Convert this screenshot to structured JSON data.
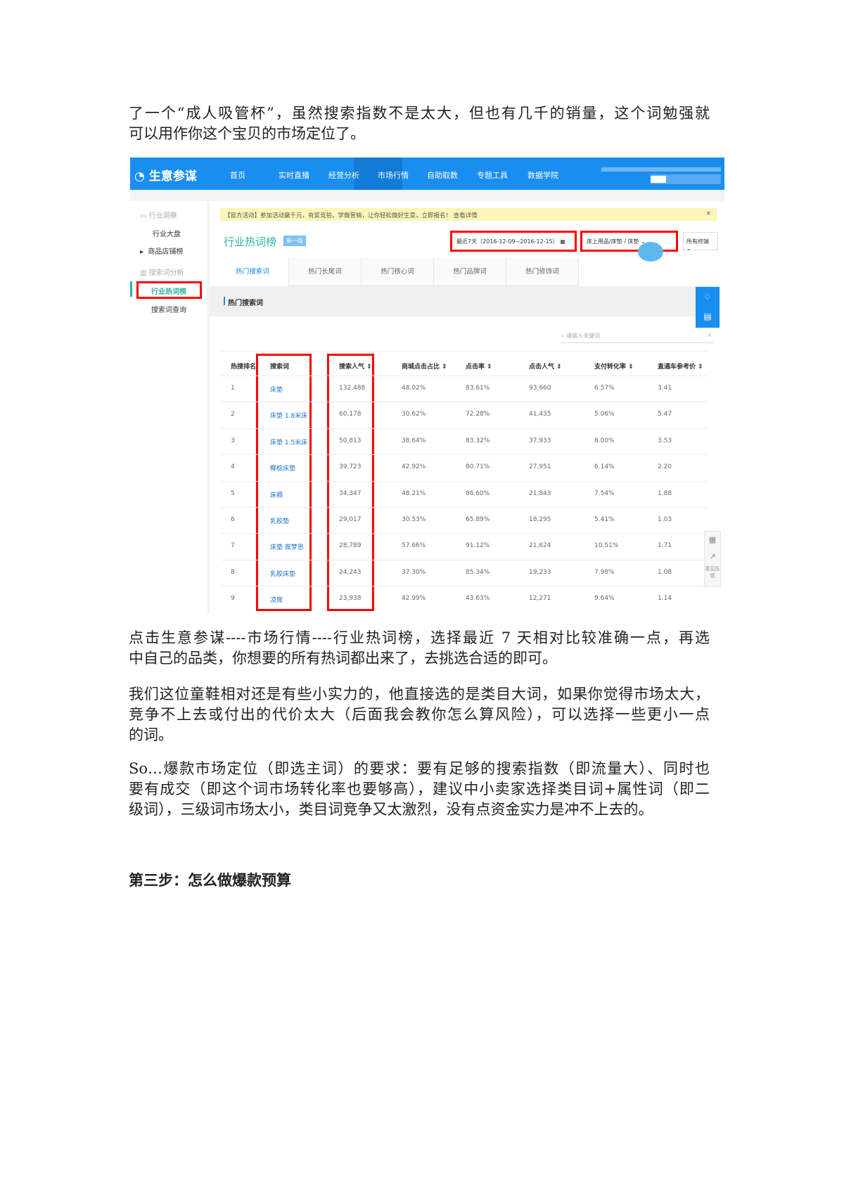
{
  "intro": {
    "lines": [
      "了一个“成人吸管杯”，虽然搜索指数不是太大，但也有几千的销量，这个词勉强就",
      "可以用作你这个宝贝的市场定位了。"
    ]
  },
  "screenshot": {
    "logo": "生意参谋",
    "nav": [
      "首页",
      "实时直播",
      "经营分析",
      "市场行情",
      "自助取数",
      "专题工具",
      "数据学院"
    ],
    "sidebar": {
      "group1": "行业洞察",
      "items1": [
        "行业大盘",
        "商品店铺榜"
      ],
      "group2": "搜索词分析",
      "active": "行业热词榜",
      "items2": [
        "搜索词查询"
      ]
    },
    "notice": "【官方活动】参加活动赢千元，有奖竞拍，学做营销，让你轻松做好生意，立即报名！ 查看详情",
    "notice_close": "×",
    "page_title": "行业热词榜",
    "badge": "新一版",
    "date_range": "最近7天（2016-12-09~2016-12-15）",
    "category": "床上用品/床垫 / 床垫",
    "terminal": "所有终端",
    "tabs": [
      "热门搜索词",
      "热门长尾词",
      "热门核心词",
      "热门品牌词",
      "热门修饰词"
    ],
    "section_title": "热门搜索词",
    "search_placeholder": "请输入关键词",
    "columns": [
      "热搜排名",
      "搜索词",
      "搜索人气 ⇕",
      "商城点击占比 ⇕",
      "点击率 ⇕",
      "点击人气 ⇕",
      "支付转化率 ⇕",
      "直通车参考价 ⇕"
    ],
    "rows": [
      [
        "1",
        "床垫",
        "132,488",
        "48.02%",
        "83.61%",
        "93,660",
        "6.57%",
        "3.41"
      ],
      [
        "2",
        "床垫 1.8米床",
        "60,178",
        "30.62%",
        "72.28%",
        "41,435",
        "5.06%",
        "5.47"
      ],
      [
        "3",
        "床垫 1.5米床",
        "50,813",
        "38.64%",
        "83.32%",
        "37,933",
        "8.00%",
        "3.53"
      ],
      [
        "4",
        "椰棕床垫",
        "39,723",
        "42.92%",
        "80.71%",
        "27,951",
        "6.14%",
        "2.20"
      ],
      [
        "5",
        "床褥",
        "34,347",
        "48.21%",
        "86.60%",
        "21,843",
        "7.54%",
        "1.88"
      ],
      [
        "6",
        "乳胶垫",
        "29,017",
        "30.53%",
        "65.89%",
        "18,295",
        "5.41%",
        "1.03"
      ],
      [
        "7",
        "床垫 席梦思",
        "28,789",
        "57.66%",
        "91.12%",
        "21,624",
        "10.51%",
        "1.71"
      ],
      [
        "8",
        "乳胶床垫",
        "24,243",
        "37.30%",
        "85.34%",
        "19,233",
        "7.98%",
        "1.08"
      ],
      [
        "9",
        "凉席",
        "23,938",
        "42.99%",
        "43.63%",
        "12,271",
        "9.64%",
        "1.14"
      ]
    ],
    "feedback": "意见反馈"
  },
  "para2": {
    "lines": [
      "点击生意参谋----市场行情----行业热词榜，选择最近 7 天相对比较准确一点，再选",
      "中自己的品类，你想要的所有热词都出来了，去挑选合适的即可。"
    ]
  },
  "para3": {
    "lines": [
      "我们这位童鞋相对还是有些小实力的，他直接选的是类目大词，如果你觉得市场太大，",
      "竞争不上去或付出的代价太大（后面我会教你怎么算风险），可以选择一些更小一点",
      "的词。"
    ]
  },
  "para4": {
    "lines": [
      "So…爆款市场定位（即选主词）的要求：要有足够的搜索指数（即流量大）、同时也",
      "要有成交（即这个词市场转化率也要够高），建议中小卖家选择类目词+属性词（即二",
      "级词），三级词市场太小，类目词竞争又太激烈，没有点资金实力是冲不上去的。"
    ]
  },
  "heading": "第三步：怎么做爆款预算"
}
